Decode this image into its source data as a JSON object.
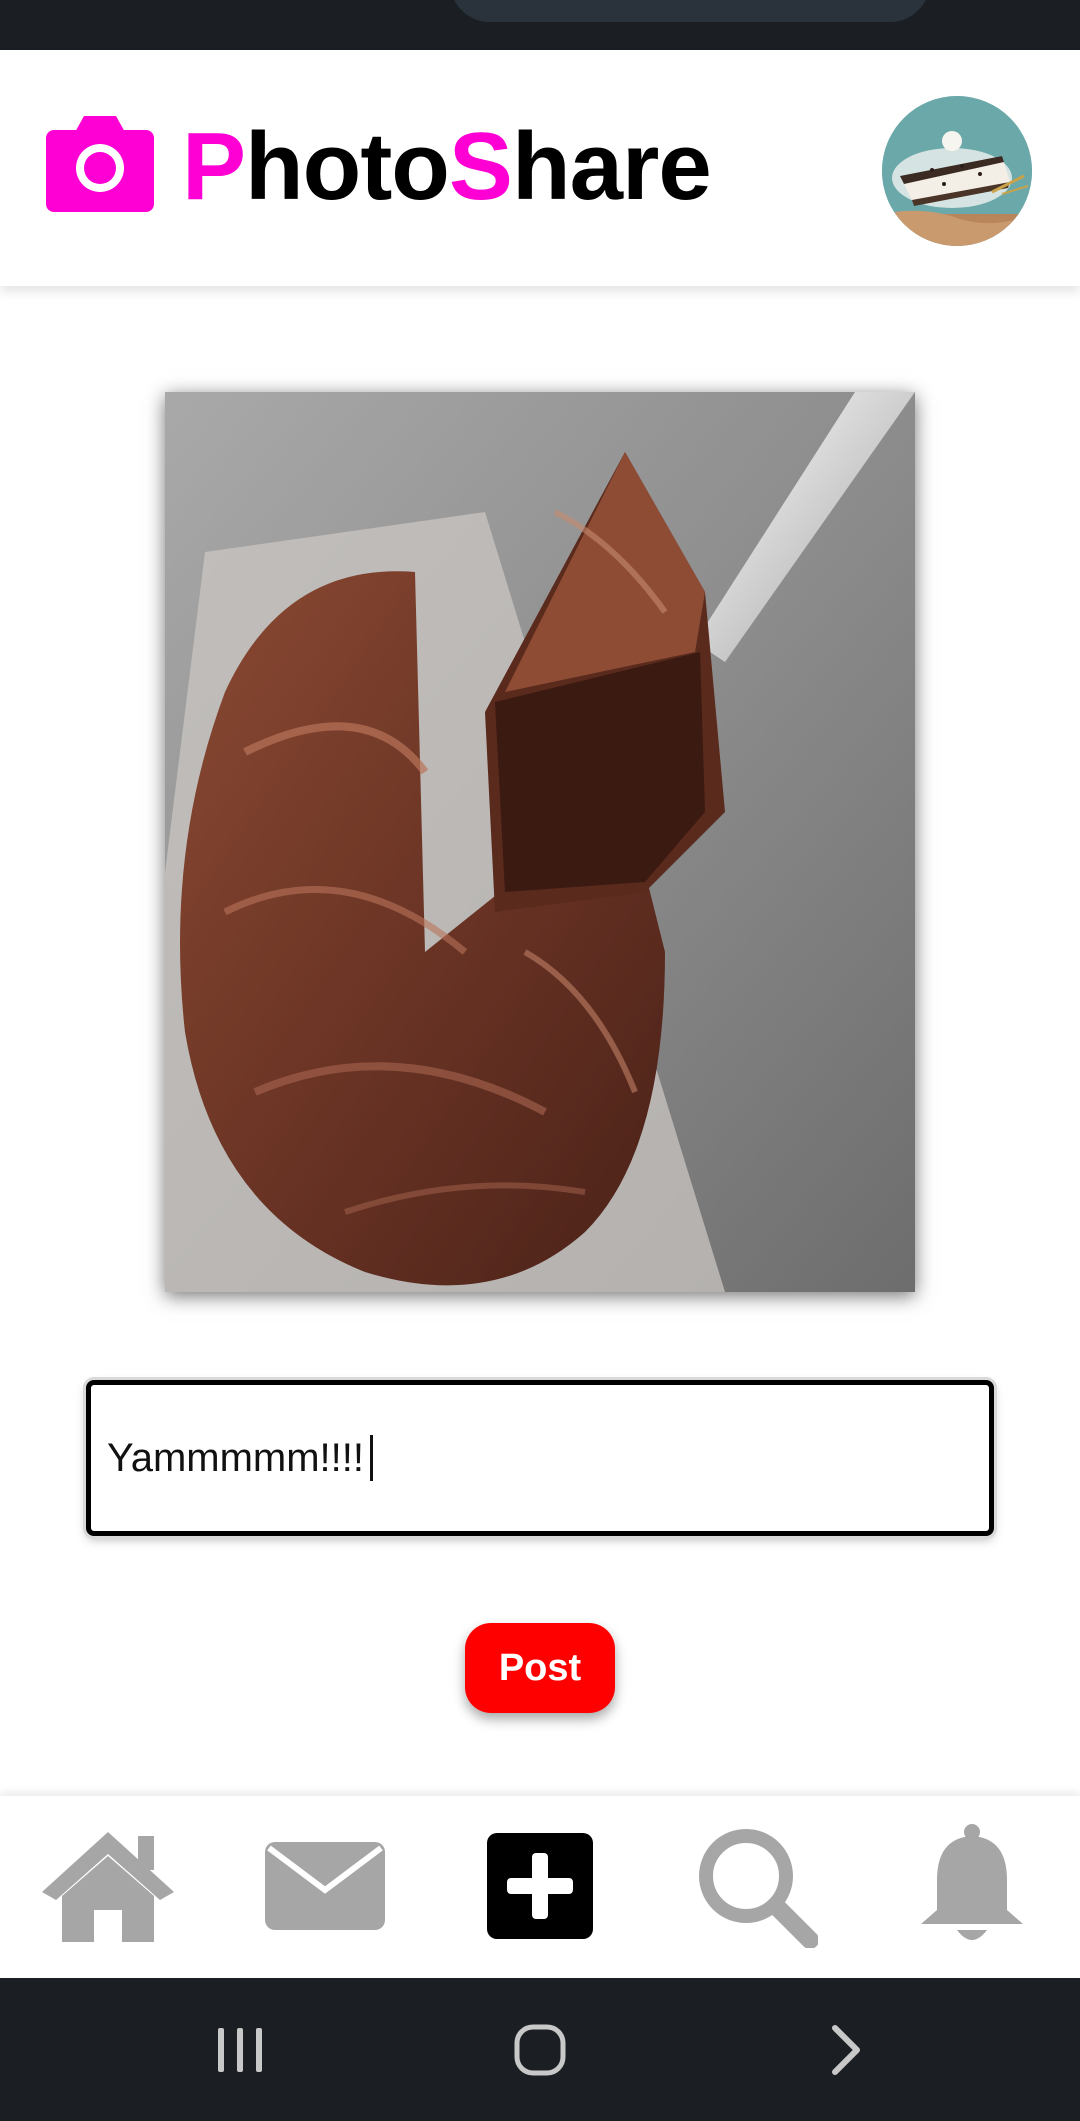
{
  "app": {
    "title_part1_accent": "P",
    "title_part2": "hoto",
    "title_part3_accent": "S",
    "title_part4": "hare",
    "accent_color": "#ff00d4",
    "logo_icon": "camera-icon",
    "avatar_icon": "user-avatar"
  },
  "post": {
    "photo_subject": "chocolate-cake-photo",
    "caption_value": "Yammmmm!!!!",
    "post_label": "Post",
    "post_color": "#ff0000"
  },
  "bottom_nav": {
    "items": [
      {
        "icon": "home-icon",
        "active": false
      },
      {
        "icon": "mail-icon",
        "active": false
      },
      {
        "icon": "add-icon",
        "active": true
      },
      {
        "icon": "search-icon",
        "active": false
      },
      {
        "icon": "bell-icon",
        "active": false
      }
    ],
    "inactive_color": "#a6a6a6",
    "active_color": "#000000"
  },
  "system_nav": {
    "items": [
      "recents-icon",
      "home-circle-icon",
      "back-chevron-icon"
    ]
  }
}
